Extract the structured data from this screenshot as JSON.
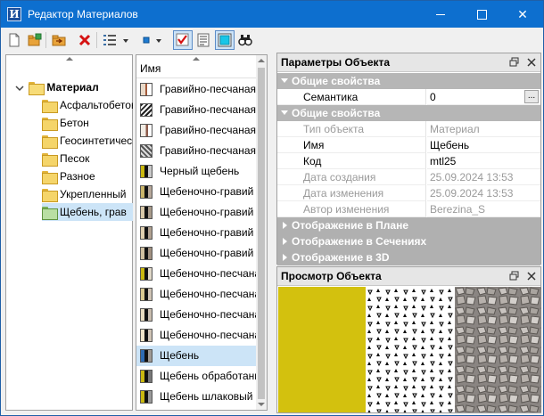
{
  "window": {
    "title": "Редактор Материалов",
    "icon_letter": "И"
  },
  "colors": {
    "titlebar": "#0d6fcf",
    "selection": "#cce4f7",
    "preview_yellow": "#d3c10e"
  },
  "tree": {
    "root": "Материал",
    "items": [
      {
        "label": "Асфальтобетон"
      },
      {
        "label": "Бетон"
      },
      {
        "label": "Геосинтетические"
      },
      {
        "label": "Песок"
      },
      {
        "label": "Разное"
      },
      {
        "label": "Укрепленный"
      },
      {
        "label": "Щебень, грав",
        "selected": true
      }
    ]
  },
  "list": {
    "header": "Имя",
    "items": [
      {
        "label": "Гравийно-песчаная"
      },
      {
        "label": "Гравийно-песчаная"
      },
      {
        "label": "Гравийно-песчаная"
      },
      {
        "label": "Гравийно-песчаная"
      },
      {
        "label": "Черный щебень"
      },
      {
        "label": "Щебеночно-гравий"
      },
      {
        "label": "Щебеночно-гравий"
      },
      {
        "label": "Щебеночно-гравий"
      },
      {
        "label": "Щебеночно-гравий"
      },
      {
        "label": "Щебеночно-песчана"
      },
      {
        "label": "Щебеночно-песчана"
      },
      {
        "label": "Щебеночно-песчана"
      },
      {
        "label": "Щебеночно-песчана"
      },
      {
        "label": "Щебень",
        "selected": true
      },
      {
        "label": "Щебень обработанн"
      },
      {
        "label": "Щебень шлаковый"
      }
    ]
  },
  "properties": {
    "title": "Параметры Объекта",
    "cat1": "Общие свойства",
    "semantics_label": "Семантика",
    "semantics_value": "0",
    "ellipsis": "...",
    "cat2": "Общие свойства",
    "rows": [
      {
        "name": "Тип объекта",
        "value": "Материал"
      },
      {
        "name": "Имя",
        "value": "Щебень"
      },
      {
        "name": "Код",
        "value": "mtl25"
      },
      {
        "name": "Дата создания",
        "value": "25.09.2024 13:53"
      },
      {
        "name": "Дата изменения",
        "value": "25.09.2024 13:53"
      },
      {
        "name": "Автор изменения",
        "value": "Berezina_S"
      }
    ],
    "cat_plan": "Отображение в Плане",
    "cat_sections": "Отображение в Сечениях",
    "cat_3d": "Отображение в 3D"
  },
  "preview": {
    "title": "Просмотр Объекта"
  }
}
